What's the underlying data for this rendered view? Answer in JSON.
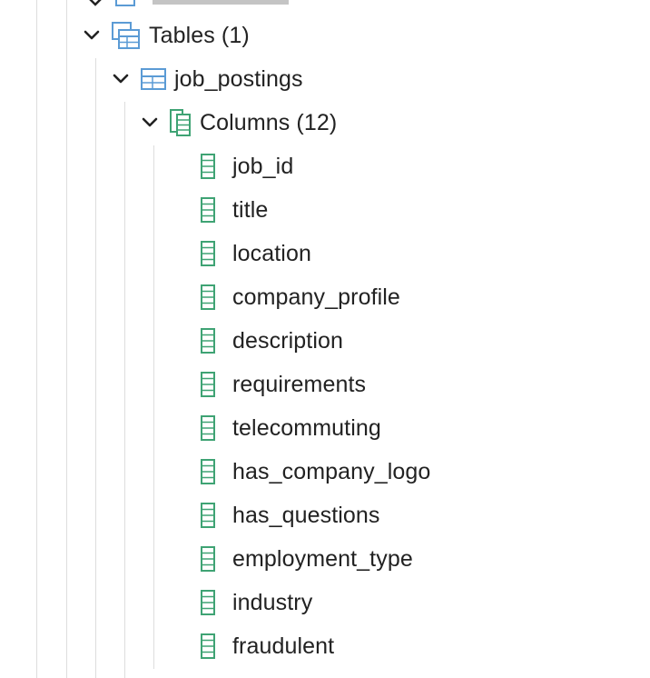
{
  "tree": {
    "tables_node": {
      "label": "Tables (1)",
      "icon": "tables-icon"
    },
    "table_node": {
      "label": "job_postings",
      "icon": "table-icon"
    },
    "columns_node": {
      "label": "Columns (12)",
      "icon": "columns-icon"
    },
    "columns": [
      "job_id",
      "title",
      "location",
      "company_profile",
      "description",
      "requirements",
      "telecommuting",
      "has_company_logo",
      "has_questions",
      "employment_type",
      "industry",
      "fraudulent"
    ]
  },
  "colors": {
    "guide_line": "#dddddd",
    "table_icon": "#5b9bd5",
    "column_icon": "#3fa374",
    "text": "#222222"
  }
}
